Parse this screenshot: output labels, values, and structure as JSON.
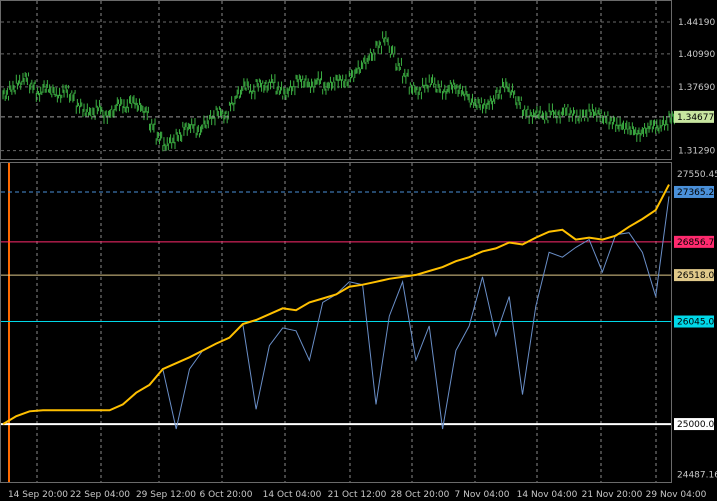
{
  "chart_data": [
    {
      "type": "bar",
      "title": "",
      "price_scale": {
        "ticks": [
          "1.44190",
          "1.40990",
          "1.37690",
          "1.31290"
        ],
        "tick_values": [
          1.4419,
          1.4099,
          1.3769,
          1.3129
        ],
        "ylim": [
          1.3075,
          1.46
        ]
      },
      "current_value": {
        "label": "1.34677",
        "value": 1.34677
      },
      "bar_color": "#3cb043",
      "x": [
        0,
        1,
        2,
        3,
        4,
        5,
        6,
        7,
        8,
        9,
        10,
        11,
        12,
        13,
        14,
        15,
        16,
        17,
        18,
        19,
        20,
        21,
        22,
        23,
        24,
        25,
        26,
        27,
        28,
        29,
        30,
        31,
        32,
        33,
        34,
        35,
        36,
        37,
        38,
        39,
        40,
        41,
        42,
        43,
        44,
        45,
        46,
        47,
        48,
        49,
        50,
        51,
        52,
        53,
        54,
        55,
        56,
        57,
        58,
        59,
        60,
        61,
        62,
        63,
        64,
        65,
        66,
        67,
        68,
        69,
        70,
        71,
        72,
        73,
        74,
        75,
        76,
        77,
        78,
        79,
        80,
        81,
        82,
        83,
        84,
        85,
        86,
        87,
        88,
        89,
        90,
        91,
        92,
        93,
        94,
        95,
        96,
        97,
        98,
        99,
        100
      ],
      "values": [
        1.369,
        1.375,
        1.381,
        1.386,
        1.378,
        1.37,
        1.376,
        1.372,
        1.368,
        1.374,
        1.368,
        1.358,
        1.352,
        1.35,
        1.356,
        1.348,
        1.352,
        1.36,
        1.356,
        1.362,
        1.358,
        1.352,
        1.338,
        1.326,
        1.318,
        1.322,
        1.328,
        1.336,
        1.338,
        1.332,
        1.34,
        1.346,
        1.352,
        1.348,
        1.36,
        1.37,
        1.378,
        1.372,
        1.38,
        1.378,
        1.382,
        1.374,
        1.37,
        1.376,
        1.384,
        1.382,
        1.378,
        1.384,
        1.376,
        1.38,
        1.384,
        1.382,
        1.388,
        1.395,
        1.402,
        1.409,
        1.418,
        1.425,
        1.412,
        1.398,
        1.388,
        1.376,
        1.372,
        1.378,
        1.382,
        1.376,
        1.372,
        1.378,
        1.374,
        1.37,
        1.362,
        1.36,
        1.358,
        1.362,
        1.37,
        1.378,
        1.372,
        1.362,
        1.352,
        1.348,
        1.35,
        1.346,
        1.352,
        1.348,
        1.354,
        1.35,
        1.346,
        1.348,
        1.352,
        1.35,
        1.346,
        1.342,
        1.338,
        1.336,
        1.334,
        1.33,
        1.334,
        1.338,
        1.336,
        1.34,
        1.346
      ]
    },
    {
      "type": "line",
      "title": "",
      "ylim": [
        24430,
        27640
      ],
      "y_ticks": [
        "27550.45",
        "24487.16"
      ],
      "y_tick_values": [
        27550.45,
        24487.16
      ],
      "x_ticks": [
        "14 Sep 20:00",
        "22 Sep 04:00",
        "29 Sep 12:00",
        "6 Oct 20:00",
        "14 Oct 04:00",
        "21 Oct 12:00",
        "28 Oct 20:00",
        "7 Nov 04:00",
        "14 Nov 04:00",
        "21 Nov 20:00",
        "29 Nov 04:00"
      ],
      "levels": [
        {
          "label": "27365.2",
          "value": 27365.2,
          "color": "#4a90d9",
          "style": "dashed"
        },
        {
          "label": "26856.7",
          "value": 26856.7,
          "color": "#ff2a6e",
          "style": "solid"
        },
        {
          "label": "26518.0",
          "value": 26518.0,
          "color": "#e0c98a",
          "style": "solid"
        },
        {
          "label": "26045.0",
          "value": 26045.0,
          "color": "#00d8e8",
          "style": "solid"
        },
        {
          "label": "25000.0",
          "value": 25000.0,
          "color": "#ffffff",
          "style": "solid"
        }
      ],
      "series": [
        {
          "color": "#ffc000",
          "x": [
            0,
            2,
            4,
            6,
            8,
            10,
            12,
            14,
            16,
            18,
            20,
            22,
            24,
            26,
            28,
            30,
            32,
            34,
            36,
            38,
            40,
            42,
            44,
            46,
            48,
            50,
            52,
            54,
            56,
            58,
            60,
            62,
            64,
            66,
            68,
            70,
            72,
            74,
            76,
            78,
            80,
            82,
            84,
            86,
            88,
            90,
            92,
            94,
            96,
            98,
            100
          ],
          "y": [
            25000,
            25080,
            25130,
            25140,
            25140,
            25140,
            25140,
            25140,
            25140,
            25200,
            25320,
            25400,
            25560,
            25620,
            25680,
            25750,
            25820,
            25880,
            26020,
            26060,
            26120,
            26180,
            26160,
            26240,
            26280,
            26320,
            26400,
            26420,
            26450,
            26480,
            26500,
            26520,
            26560,
            26600,
            26660,
            26700,
            26760,
            26790,
            26850,
            26830,
            26900,
            26960,
            26980,
            26880,
            26900,
            26880,
            26920,
            27010,
            27090,
            27180,
            27440
          ]
        },
        {
          "color": "#6a8fc8",
          "x": [
            0,
            2,
            4,
            6,
            8,
            10,
            12,
            14,
            16,
            18,
            20,
            22,
            24,
            26,
            28,
            30,
            32,
            34,
            36,
            38,
            40,
            42,
            44,
            46,
            48,
            50,
            52,
            54,
            56,
            58,
            60,
            62,
            64,
            66,
            68,
            70,
            72,
            74,
            76,
            78,
            80,
            82,
            84,
            86,
            88,
            90,
            92,
            94,
            96,
            98,
            100
          ],
          "y": [
            25000,
            25080,
            25130,
            25140,
            25140,
            25140,
            25140,
            25140,
            25140,
            25200,
            25320,
            25400,
            25560,
            24950,
            25560,
            25750,
            25820,
            25880,
            26020,
            25150,
            25800,
            25980,
            25950,
            25650,
            26240,
            26320,
            26450,
            26420,
            25200,
            26100,
            26450,
            25650,
            26000,
            24950,
            25750,
            26000,
            26500,
            25900,
            26300,
            25300,
            26200,
            26750,
            26700,
            26800,
            26880,
            26550,
            26930,
            26950,
            26750,
            26300,
            27320
          ]
        }
      ]
    }
  ]
}
